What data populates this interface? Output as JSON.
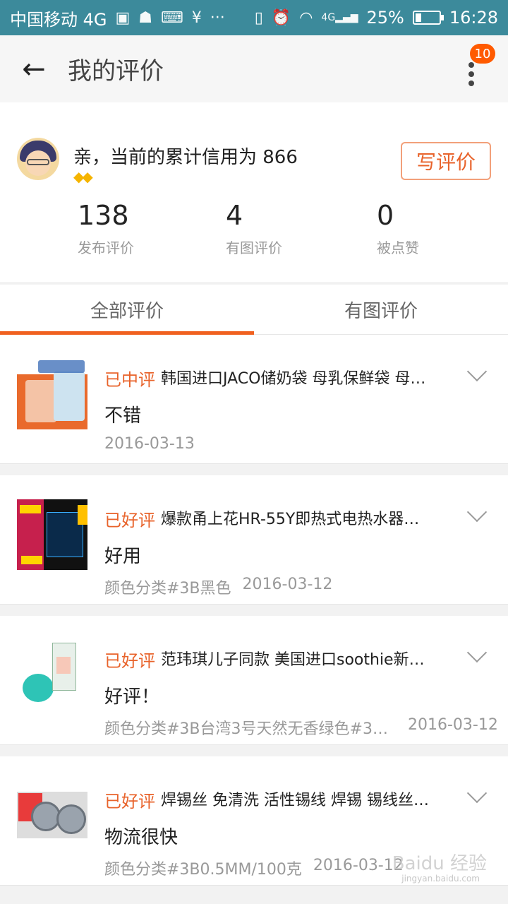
{
  "status_bar": {
    "carrier": "中国移动 4G",
    "network": "4G",
    "battery": "25%",
    "battery_level": 0.25,
    "time": "16:28"
  },
  "app_bar": {
    "title": "我的评价",
    "badge_count": "10"
  },
  "profile": {
    "credit_text": "亲，当前的累计信用为 866",
    "level_icons": "◆◆",
    "write_button": "写评价"
  },
  "stats": [
    {
      "value": "138",
      "label": "发布评价"
    },
    {
      "value": "4",
      "label": "有图评价"
    },
    {
      "value": "0",
      "label": "被点赞"
    }
  ],
  "tabs": [
    {
      "label": "全部评价",
      "active": true
    },
    {
      "label": "有图评价",
      "active": false
    }
  ],
  "reviews": [
    {
      "status": "已中评",
      "product": "韩国进口JACO储奶袋 母乳保鲜袋 母…",
      "comment": "不错",
      "sku": "",
      "date": "2016-03-13"
    },
    {
      "status": "已好评",
      "product": "爆款甬上花HR-55Y即热式电热水器…",
      "comment": "好用",
      "sku": "颜色分类#3B黑色",
      "date": "2016-03-12"
    },
    {
      "status": "已好评",
      "product": "范玮琪儿子同款 美国进口soothie新…",
      "comment": "好评！",
      "sku": "颜色分类#3B台湾3号天然无香绿色#3…",
      "date": "2016-03-12"
    },
    {
      "status": "已好评",
      "product": "焊锡丝 免清洗 活性锡线 焊锡 锡线丝…",
      "comment": "物流很快",
      "sku": "颜色分类#3B0.5MM/100克",
      "date": "2016-03-12"
    }
  ],
  "watermark": {
    "text": "Baidu 经验",
    "sub": "jingyan.baidu.com"
  },
  "colors": {
    "status_bar": "#3c8a9b",
    "accent": "#e8632b",
    "tab_indicator": "#f0601f",
    "badge": "#ff5a00"
  }
}
